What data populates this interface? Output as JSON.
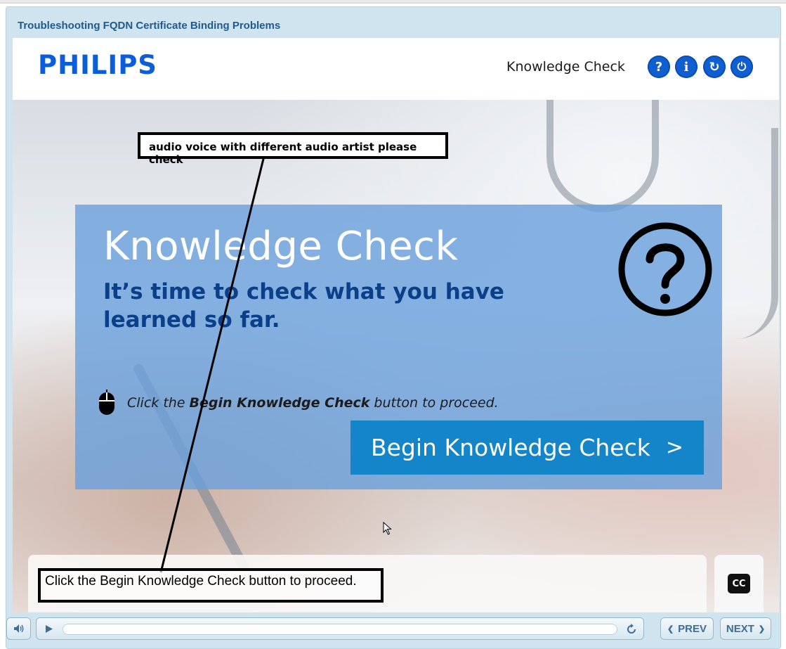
{
  "window": {
    "course_title": "Troubleshooting FQDN Certificate Binding Problems"
  },
  "header": {
    "logo": "PHILIPS",
    "title": "Knowledge Check",
    "buttons": [
      {
        "name": "help-button",
        "glyph": "?"
      },
      {
        "name": "info-button",
        "glyph": "i"
      },
      {
        "name": "restart-button",
        "glyph": "↻"
      },
      {
        "name": "exit-button",
        "glyph": "⏻"
      }
    ]
  },
  "slide": {
    "title": "Knowledge Check",
    "subtitle": "It’s time to check what you have learned so far.",
    "instruction_prefix": "Click the ",
    "instruction_bold": "Begin Knowledge Check",
    "instruction_suffix": " button to proceed.",
    "begin_button_label": "Begin Knowledge Check",
    "begin_button_chevron": ">"
  },
  "caption": {
    "cc_label": "CC"
  },
  "annotations": {
    "top_note": "audio voice with different audio artist please check",
    "bottom_note": "Click the Begin Knowledge Check button to proceed."
  },
  "player": {
    "prev_label": "PREV",
    "next_label": "NEXT",
    "prev_chevron": "❮",
    "next_chevron": "❯",
    "progress": 0
  },
  "colors": {
    "brand_blue": "#0b5ed7",
    "card_blue": "#69a0dc",
    "button_blue": "#1485c8",
    "subtitle_navy": "#0a3f8a"
  }
}
